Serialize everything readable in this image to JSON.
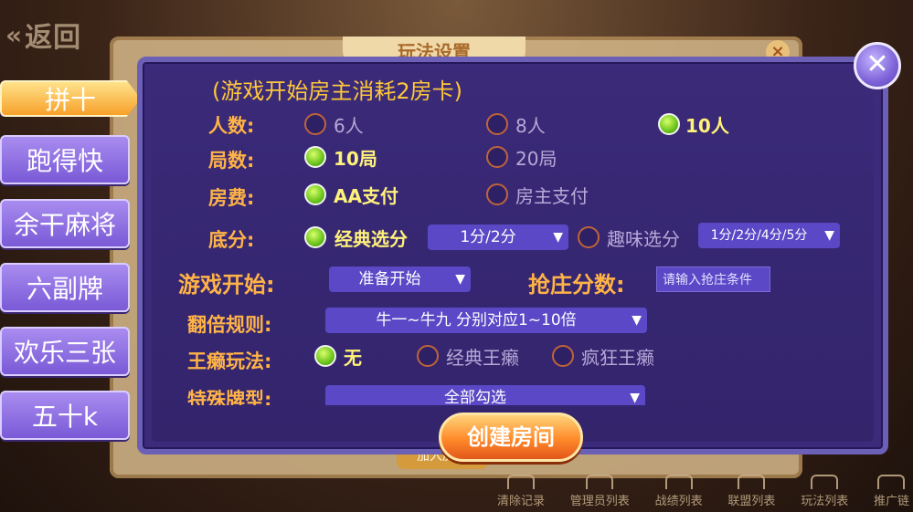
{
  "background": {
    "back_label": "返回",
    "panel_title": "玩法设置",
    "bottom_button": "加入房间",
    "bottom_bar": [
      "清除记录",
      "管理员列表",
      "战绩列表",
      "联盟列表",
      "玩法列表",
      "推广链"
    ]
  },
  "tabs": [
    {
      "label": "拼十",
      "active": true
    },
    {
      "label": "跑得快",
      "active": false
    },
    {
      "label": "余干麻将",
      "active": false
    },
    {
      "label": "六副牌",
      "active": false
    },
    {
      "label": "欢乐三张",
      "active": false
    },
    {
      "label": "五十k",
      "active": false
    }
  ],
  "notice": "(游戏开始房主消耗2房卡)",
  "players": {
    "label": "人数:",
    "options": [
      "6人",
      "8人",
      "10人"
    ],
    "selected": "10人"
  },
  "rounds": {
    "label": "局数:",
    "options": [
      "10局",
      "20局"
    ],
    "selected": "10局"
  },
  "fee": {
    "label": "房费:",
    "options": [
      "AA支付",
      "房主支付"
    ],
    "selected": "AA支付"
  },
  "base_score": {
    "label": "底分:",
    "classic_label": "经典选分",
    "classic_value": "1分/2分",
    "fun_label": "趣味选分",
    "fun_value": "1分/2分/4分/5分",
    "selected": "经典选分"
  },
  "game_start": {
    "label": "游戏开始:",
    "value": "准备开始"
  },
  "banker_score": {
    "label": "抢庄分数:",
    "placeholder": "请输入抢庄条件"
  },
  "double_rule": {
    "label": "翻倍规则:",
    "value": "牛一~牛九 分别对应1~10倍"
  },
  "wild": {
    "label": "王癞玩法:",
    "options": [
      "无",
      "经典王癞",
      "疯狂王癞"
    ],
    "selected": "无"
  },
  "special": {
    "label": "特殊牌型:",
    "value": "全部勾选"
  },
  "create_button": "创建房间",
  "colors": {
    "accent": "#ffb347",
    "dialog": "#3c2a7a",
    "button": "#ff8a2a",
    "selected_radio": "#6bc41c"
  }
}
